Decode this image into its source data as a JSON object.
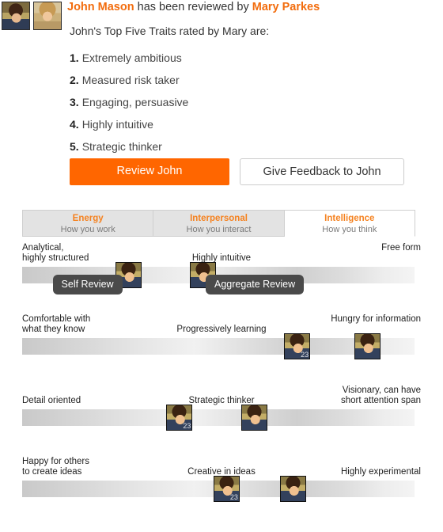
{
  "header": {
    "subject_name": "John Mason",
    "middle_text": "has been reviewed by",
    "reviewer_name": "Mary Parkes",
    "avatars": [
      {
        "name": "john-avatar",
        "alt": "John Mason"
      },
      {
        "name": "mary-avatar",
        "alt": "Mary Parkes"
      }
    ]
  },
  "traits": {
    "intro": "John's Top Five Traits rated by Mary are:",
    "items": [
      {
        "num": "1.",
        "label": "Extremely ambitious"
      },
      {
        "num": "2.",
        "label": "Measured risk taker"
      },
      {
        "num": "3.",
        "label": "Engaging, persuasive"
      },
      {
        "num": "4.",
        "label": "Highly intuitive"
      },
      {
        "num": "5.",
        "label": "Strategic thinker"
      }
    ]
  },
  "actions": {
    "primary_label": "Review John",
    "secondary_label": "Give Feedback to John",
    "primary_color": "#ff6600"
  },
  "tabs": {
    "accent_color": "#f58220",
    "items": [
      {
        "title": "Energy",
        "subtitle": "How you work",
        "active": false
      },
      {
        "title": "Interpersonal",
        "subtitle": "How you interact",
        "active": false
      },
      {
        "title": "Intelligence",
        "subtitle": "How you think",
        "active": true
      }
    ]
  },
  "sliders": {
    "tooltip_self": "Self Review",
    "tooltip_aggregate": "Aggregate Review",
    "badge_value": "23",
    "rows": [
      {
        "left_label": "Analytical,\nhighly structured",
        "mid_label": "Highly intuitive",
        "mid_label_pct": 50,
        "right_label": "Free form",
        "markers": [
          {
            "type": "self",
            "pct": 27,
            "badge": ""
          },
          {
            "type": "aggregate",
            "pct": 46,
            "badge": "23"
          }
        ],
        "tooltips": [
          {
            "text": "Self Review",
            "pct": 11
          },
          {
            "text": "Aggregate Review",
            "pct": 50
          }
        ]
      },
      {
        "left_label": "Comfortable with\nwhat they know",
        "mid_label": "Progressively learning",
        "mid_label_pct": 50,
        "right_label": "Hungry for information",
        "markers": [
          {
            "type": "aggregate",
            "pct": 70,
            "badge": "23"
          },
          {
            "type": "self",
            "pct": 88,
            "badge": ""
          }
        ],
        "tooltips": []
      },
      {
        "left_label": "Detail oriented",
        "mid_label": "Strategic thinker",
        "mid_label_pct": 50,
        "right_label": "Visionary, can have\nshort attention span",
        "markers": [
          {
            "type": "aggregate",
            "pct": 40,
            "badge": "23"
          },
          {
            "type": "self",
            "pct": 59,
            "badge": ""
          }
        ],
        "tooltips": []
      },
      {
        "left_label": "Happy for others\nto create ideas",
        "mid_label": "Creative in ideas",
        "mid_label_pct": 50,
        "right_label": "Highly experimental",
        "markers": [
          {
            "type": "aggregate",
            "pct": 52,
            "badge": "23"
          },
          {
            "type": "self",
            "pct": 69,
            "badge": ""
          }
        ],
        "tooltips": []
      }
    ]
  }
}
